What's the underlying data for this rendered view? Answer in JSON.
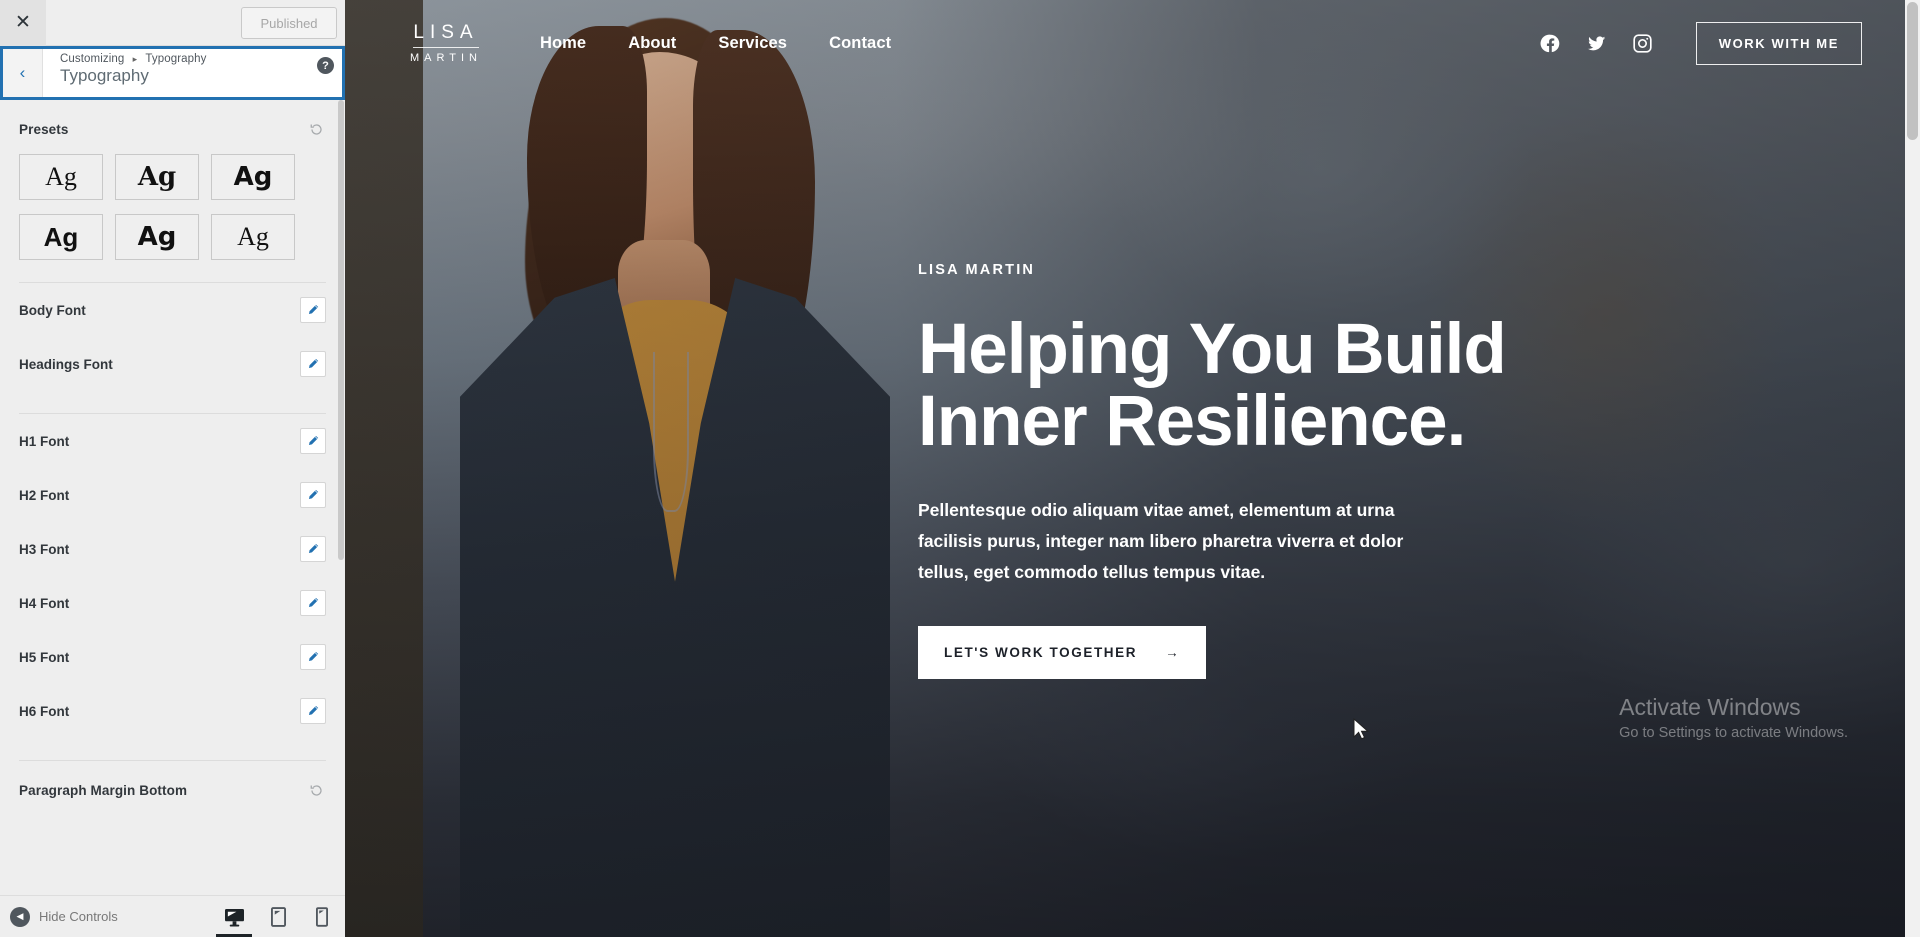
{
  "customizer": {
    "close_label": "✕",
    "publish_label": "Published",
    "back_label": "‹",
    "help_label": "?",
    "breadcrumb": {
      "root": "Customizing",
      "separator": "▸",
      "current": "Typography"
    },
    "panel_title": "Typography",
    "presets": {
      "label": "Presets",
      "reset_icon": "reset-icon",
      "tiles": [
        {
          "sample": "Ag",
          "style": "serif-light"
        },
        {
          "sample": "Ag",
          "style": "serif-bold"
        },
        {
          "sample": "Ag",
          "style": "sans-condensed-bold"
        },
        {
          "sample": "Ag",
          "style": "sans-bold"
        },
        {
          "sample": "Ag",
          "style": "sans-heavy"
        },
        {
          "sample": "Ag",
          "style": "serif-regular"
        }
      ]
    },
    "font_controls": [
      {
        "label": "Body Font",
        "edit_icon": "pencil-icon"
      },
      {
        "label": "Headings Font",
        "edit_icon": "pencil-icon"
      }
    ],
    "heading_controls": [
      {
        "label": "H1 Font",
        "edit_icon": "pencil-icon"
      },
      {
        "label": "H2 Font",
        "edit_icon": "pencil-icon"
      },
      {
        "label": "H3 Font",
        "edit_icon": "pencil-icon"
      },
      {
        "label": "H4 Font",
        "edit_icon": "pencil-icon"
      },
      {
        "label": "H5 Font",
        "edit_icon": "pencil-icon"
      },
      {
        "label": "H6 Font",
        "edit_icon": "pencil-icon"
      }
    ],
    "paragraph_margin": {
      "label": "Paragraph Margin Bottom",
      "reset_icon": "reset-icon"
    },
    "footer": {
      "hide_controls_label": "Hide Controls",
      "devices": [
        {
          "name": "desktop",
          "active": true
        },
        {
          "name": "tablet",
          "active": false
        },
        {
          "name": "mobile",
          "active": false
        }
      ]
    },
    "accent_color": "#2271b1",
    "panel_bg": "#eeeeee"
  },
  "preview": {
    "header": {
      "logo_line1": "LISA",
      "logo_line2": "MARTIN",
      "nav": [
        {
          "label": "Home"
        },
        {
          "label": "About"
        },
        {
          "label": "Services"
        },
        {
          "label": "Contact"
        }
      ],
      "socials": [
        {
          "name": "facebook-icon"
        },
        {
          "name": "twitter-icon"
        },
        {
          "name": "instagram-icon"
        }
      ],
      "cta_label": "WORK WITH ME"
    },
    "hero": {
      "eyebrow": "LISA MARTIN",
      "heading_line1": "Helping You Build",
      "heading_line2": "Inner Resilience.",
      "paragraph": "Pellentesque odio aliquam vitae amet, elementum at urna facilisis purus, integer nam libero pharetra viverra et dolor tellus, eget commodo tellus tempus vitae.",
      "cta_label": "LET'S WORK TOGETHER",
      "cta_arrow": "→"
    },
    "watermark": {
      "line1": "Activate Windows",
      "line2": "Go to Settings to activate Windows."
    }
  }
}
